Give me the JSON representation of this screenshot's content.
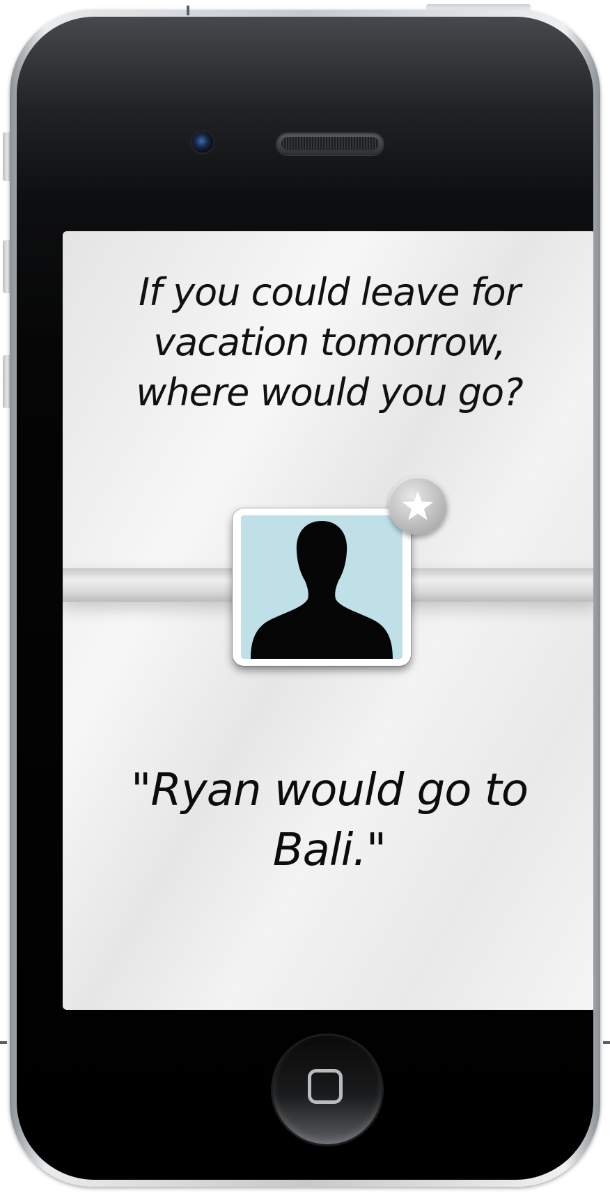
{
  "screen": {
    "question": "If you could leave for vacation tomorrow, where would you go?",
    "answer": "\"Ryan would go to Bali.\"",
    "avatar_icon": "person-silhouette-icon",
    "badge_icon": "star-icon",
    "colors": {
      "avatar_background": "#bfe0e6",
      "text": "#111111",
      "badge": "#bdbdbd"
    }
  },
  "device": {
    "home_icon": "rounded-square-icon",
    "camera_icon": "front-camera-icon"
  }
}
